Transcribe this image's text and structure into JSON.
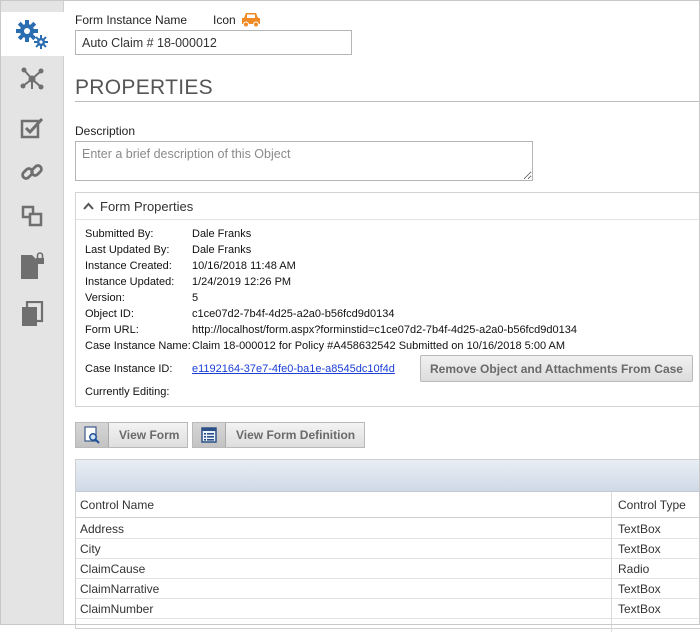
{
  "rail": {
    "items": [
      {
        "icon": "gears-icon",
        "active": true
      },
      {
        "icon": "network-icon",
        "active": false
      },
      {
        "icon": "checkbox-icon",
        "active": false
      },
      {
        "icon": "link-icon",
        "active": false
      },
      {
        "icon": "copy-boxes-icon",
        "active": false
      },
      {
        "icon": "locked-document-icon",
        "active": false
      },
      {
        "icon": "documents-icon",
        "active": false
      }
    ]
  },
  "header": {
    "instance_name_label": "Form Instance Name",
    "icon_label": "Icon",
    "instance_name_value": "Auto Claim # 18-000012",
    "car_icon_color": "#f08a24"
  },
  "properties": {
    "title": "PROPERTIES",
    "description_label": "Description",
    "description_placeholder": "Enter a brief description of this Object"
  },
  "form_properties": {
    "title": "Form Properties",
    "submitted_by_label": "Submitted By:",
    "submitted_by": "Dale Franks",
    "last_updated_by_label": "Last Updated By:",
    "last_updated_by": "Dale Franks",
    "instance_created_label": "Instance Created:",
    "instance_created": "10/16/2018 11:48 AM",
    "instance_updated_label": "Instance Updated:",
    "instance_updated": "1/24/2019 12:26 PM",
    "version_label": "Version:",
    "version": "5",
    "object_id_label": "Object ID:",
    "object_id": "c1ce07d2-7b4f-4d25-a2a0-b56fcd9d0134",
    "form_url_label": "Form URL:",
    "form_url": "http://localhost/form.aspx?forminstid=c1ce07d2-7b4f-4d25-a2a0-b56fcd9d0134",
    "case_instance_name_label": "Case Instance Name:",
    "case_instance_name": "Claim 18-000012 for Policy #A458632542 Submitted on 10/16/2018 5:00 AM",
    "case_instance_id_label": "Case Instance ID:",
    "case_instance_id": "e1192164-37e7-4fe0-ba1e-a8545dc10f4d",
    "currently_editing_label": "Currently Editing:",
    "remove_button_label": "Remove Object and Attachments From Case"
  },
  "buttons": {
    "view_form_label": "View Form",
    "view_form_definition_label": "View Form Definition"
  },
  "controls_table": {
    "columns": [
      "Control Name",
      "Control Type"
    ],
    "rows": [
      {
        "name": "Address",
        "type": "TextBox"
      },
      {
        "name": "City",
        "type": "TextBox"
      },
      {
        "name": "ClaimCause",
        "type": "Radio"
      },
      {
        "name": "ClaimNarrative",
        "type": "TextBox"
      },
      {
        "name": "ClaimNumber",
        "type": "TextBox"
      }
    ]
  },
  "colors": {
    "accent_blue": "#2a6db0",
    "icon_gray": "#6f6f6f",
    "link_blue": "#1a3fd6",
    "car_orange": "#f08a24"
  }
}
